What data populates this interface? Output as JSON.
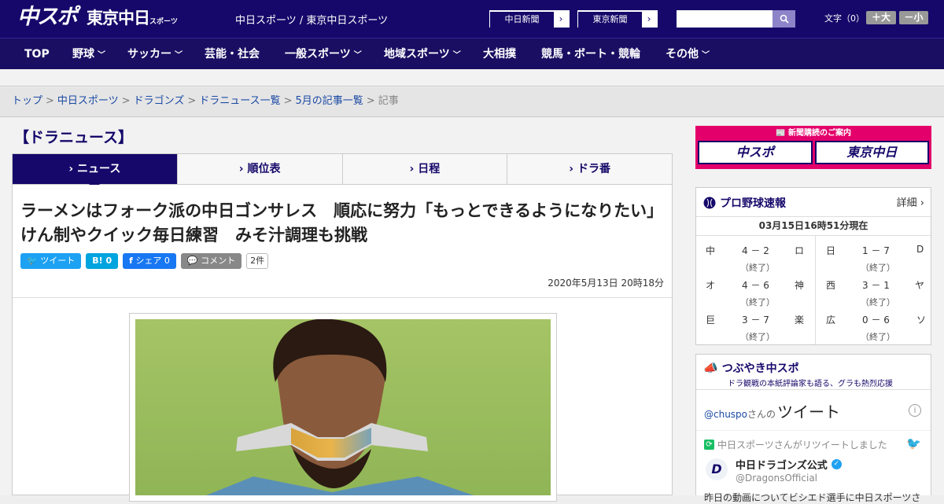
{
  "header": {
    "logo_chuspo": "中スポ",
    "logo_tokyo": "東京中日",
    "logo_tokyo_sub": "スポーツ",
    "site_name": "中日スポーツ / 東京中日スポーツ",
    "paper_links": [
      {
        "label": "中日新聞"
      },
      {
        "label": "東京新聞"
      }
    ],
    "search_placeholder": "",
    "font_label": "文字（0）",
    "font_larger": "＋大",
    "font_smaller": "－小"
  },
  "nav": {
    "items": [
      {
        "label": "TOP",
        "dropdown": false
      },
      {
        "label": "野球",
        "dropdown": true
      },
      {
        "label": "サッカー",
        "dropdown": true
      },
      {
        "label": "芸能・社会",
        "dropdown": false
      },
      {
        "label": "一般スポーツ",
        "dropdown": true
      },
      {
        "label": "地域スポーツ",
        "dropdown": true
      },
      {
        "label": "大相撲",
        "dropdown": false
      },
      {
        "label": "競馬・ボート・競輪",
        "dropdown": false
      },
      {
        "label": "その他",
        "dropdown": true
      }
    ]
  },
  "breadcrumb": {
    "links": [
      "トップ",
      "中日スポーツ",
      "ドラゴンズ",
      "ドラニュース一覧",
      "5月の記事一覧"
    ],
    "current": "記事",
    "separator": ">"
  },
  "section_title": "【ドラニュース】",
  "tabs": [
    {
      "label": "ニュース",
      "active": true
    },
    {
      "label": "順位表",
      "active": false
    },
    {
      "label": "日程",
      "active": false
    },
    {
      "label": "ドラ番",
      "active": false
    }
  ],
  "article": {
    "headline": "ラーメンはフォーク派の中日ゴンサレス　順応に努力「もっとできるようになりたい」けん制やクイック毎日練習　みそ汁調理も挑戦",
    "share": {
      "tweet": "ツイート",
      "hatena": "B!",
      "hatena_count": "0",
      "facebook": "シェア",
      "facebook_count": "0",
      "comment": "コメント",
      "comment_count": "2件"
    },
    "date": "2020年5月13日 20時18分"
  },
  "sidebar": {
    "ad": {
      "title": "新聞購読のご案内",
      "btn1": "中スポ",
      "btn2": "東京中日"
    },
    "baseball": {
      "title": "プロ野球速報",
      "detail": "詳細",
      "time": "03月15日16時51分現在",
      "games": [
        {
          "home": "中",
          "score": "4 － 2",
          "away": "ロ",
          "status": "（終了）"
        },
        {
          "home": "日",
          "score": "1 － 7",
          "away": "D",
          "status": "（終了）"
        },
        {
          "home": "オ",
          "score": "4 － 6",
          "away": "神",
          "status": "（終了）"
        },
        {
          "home": "西",
          "score": "3 － 1",
          "away": "ヤ",
          "status": "（終了）"
        },
        {
          "home": "巨",
          "score": "3 － 7",
          "away": "楽",
          "status": "（終了）"
        },
        {
          "home": "広",
          "score": "0 － 6",
          "away": "ソ",
          "status": "（終了）"
        }
      ]
    },
    "twitter": {
      "title": "つぶやき中スポ",
      "subtitle": "ドラ観戦の本紙評論家も語る、グラも熱烈応援",
      "handle": "@chuspo",
      "handle_suffix": "さんの",
      "tweets_label": "ツイート",
      "retweet_note": "中日スポーツさんがリツイートしました",
      "account_name": "中日ドラゴンズ公式",
      "account_handle": "@DragonsOfficial",
      "tweet_text": "昨日の動画についてビシエド選手に中日スポーツさ"
    }
  },
  "colors": {
    "brand": "#15086a",
    "nav": "#1a0e63",
    "accent": "#e4006b",
    "link": "#1b4aa5"
  }
}
